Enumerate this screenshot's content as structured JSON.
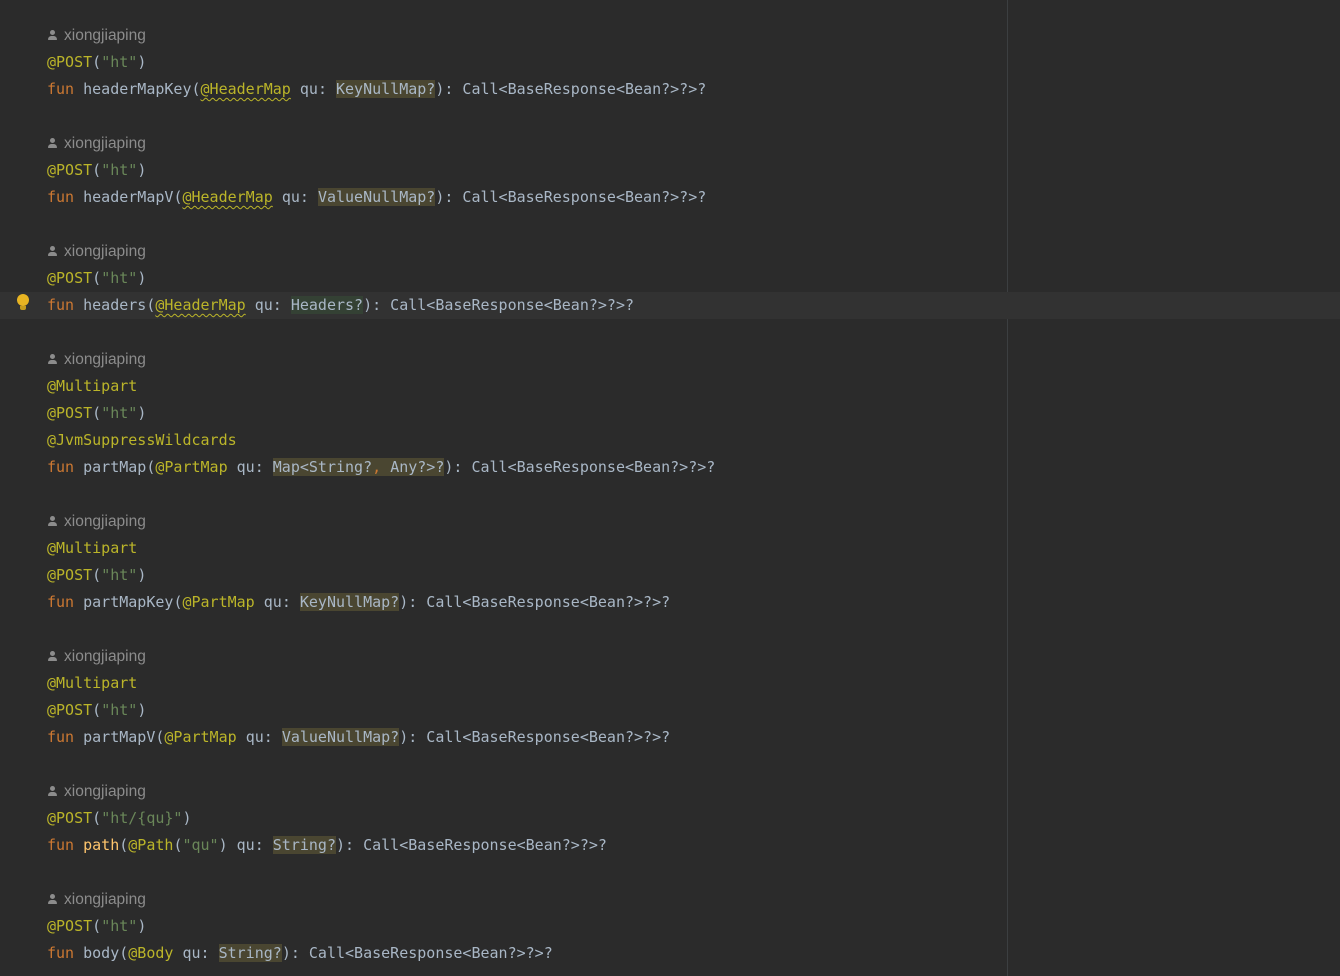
{
  "author": "xiongjiaping",
  "tokens": {
    "fun": "fun",
    "post": "@POST",
    "multipart": "@Multipart",
    "jvm": "@JvmSuppressWildcards",
    "headerMap": "@HeaderMap",
    "partMap": "@PartMap",
    "pathAnn": "@Path",
    "bodyAnn": "@Body",
    "qu": "qu",
    "colon": ": ",
    "openParen": "(",
    "closeParen": ")",
    "ret": "): Call<BaseResponse<Bean?>?>?",
    "ht": "\"ht\"",
    "htqu": "\"ht/{qu}\"",
    "quStr": "\"qu\"",
    "comma": ", "
  },
  "functions": {
    "headerMapKey": {
      "name": "headerMapKey",
      "type": "KeyNullMap?"
    },
    "headerMapV": {
      "name": "headerMapV",
      "type": "ValueNullMap?"
    },
    "headers": {
      "name": "headers",
      "type": "Headers?"
    },
    "partMap": {
      "name": "partMap",
      "type_a": "Map<String?",
      "type_b": "Any?>?"
    },
    "partMapKey": {
      "name": "partMapKey",
      "type": "KeyNullMap?"
    },
    "partMapV": {
      "name": "partMapV",
      "type": "ValueNullMap?"
    },
    "path": {
      "name": "path",
      "type": "String?"
    },
    "body": {
      "name": "body",
      "type": "String?"
    }
  },
  "colors": {
    "background": "#2b2b2b",
    "keyword": "#cc7832",
    "annotation": "#bbb529",
    "string": "#6a8759",
    "text": "#a9b7c6",
    "author": "#8c8c8c",
    "highlight": "#4a4631",
    "bulb": "#e8b422"
  },
  "icons": [
    "person-icon",
    "lightbulb-icon"
  ]
}
